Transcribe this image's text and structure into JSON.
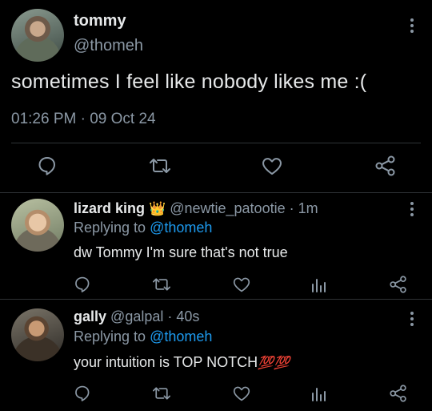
{
  "main_tweet": {
    "name": "tommy",
    "handle": "@thomeh",
    "text": "sometimes I feel like nobody likes me :(",
    "time": "01:26 PM",
    "separator": "·",
    "date": "09 Oct 24",
    "actions": [
      "reply-icon",
      "retweet-icon",
      "like-icon",
      "share-icon"
    ]
  },
  "replies": [
    {
      "name": "lizard king",
      "badge": "👑",
      "handle": "@newtie_patootie",
      "separator": "·",
      "age": "1m",
      "replying_prefix": "Replying to",
      "replying_to": "@thomeh",
      "text": "dw Tommy I'm sure that's not true"
    },
    {
      "name": "gally",
      "handle": "@galpal",
      "separator": "·",
      "age": "40s",
      "replying_prefix": "Replying to",
      "replying_to": "@thomeh",
      "text": "your intuition is TOP NOTCH",
      "emoji": "💯💯"
    }
  ],
  "colors": {
    "background": "#000000",
    "text": "#e7e9ea",
    "muted": "#8b98a5",
    "link": "#1d9bf0",
    "divider": "#2f3336"
  }
}
